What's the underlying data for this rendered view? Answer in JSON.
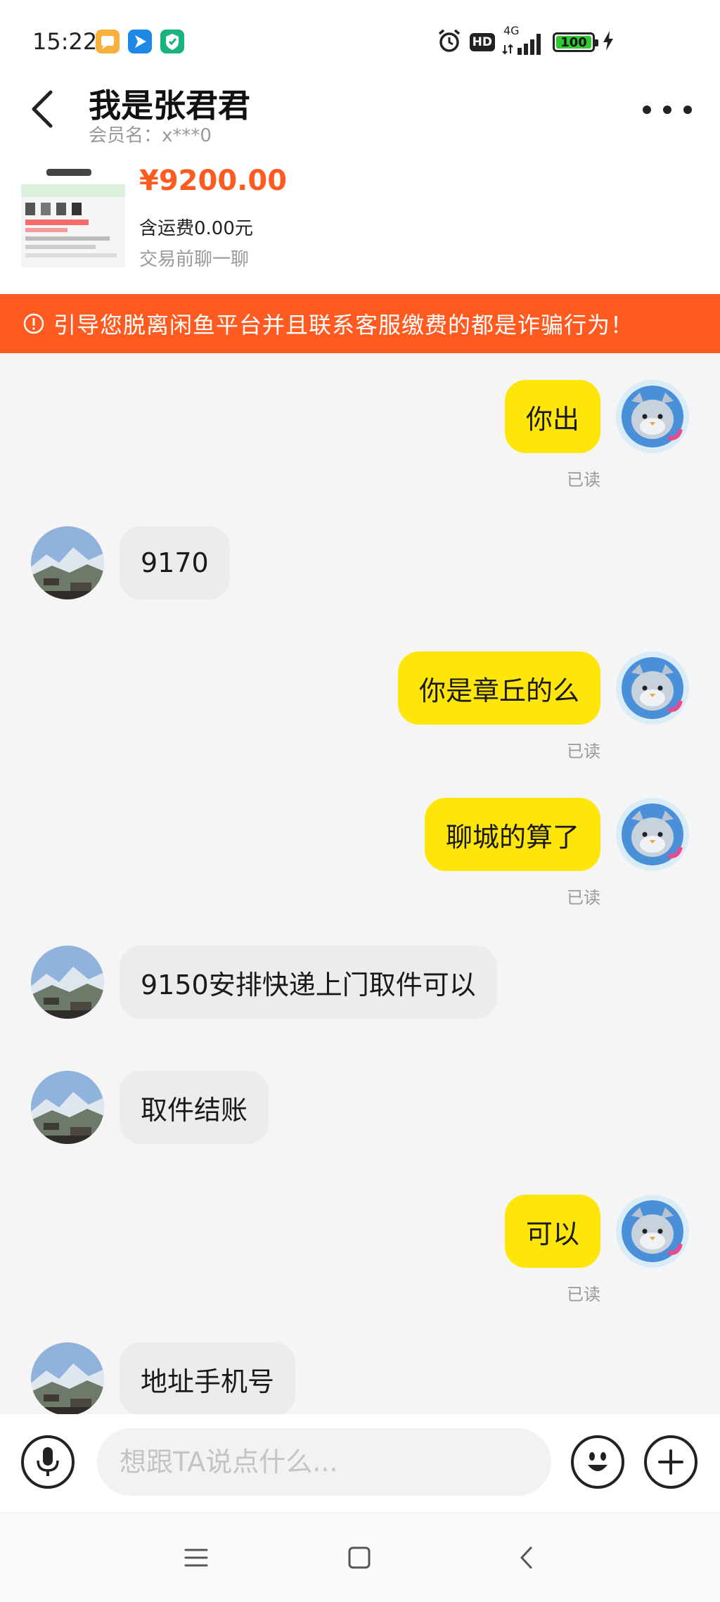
{
  "status_bar": {
    "time": "15:22",
    "network": "4G",
    "hd": "HD",
    "battery": "100",
    "icons": [
      "gallery-app-icon",
      "messenger-app-icon",
      "shield-app-icon",
      "alarm-icon",
      "hd-icon",
      "signal-icon",
      "battery-icon",
      "charging-icon"
    ]
  },
  "header": {
    "title": "我是张君君",
    "member_name": "会员名：x***0",
    "product": {
      "price": "¥9200.00",
      "shipping": "含运费0.00元",
      "hint": "交易前聊一聊"
    }
  },
  "warning": "引导您脱离闲鱼平台并且联系客服缴费的都是诈骗行为！",
  "messages": [
    {
      "from": "me",
      "text": "你出",
      "status": "已读"
    },
    {
      "from": "them",
      "text": "9170"
    },
    {
      "from": "me",
      "text": "你是章丘的么",
      "status": "已读"
    },
    {
      "from": "me",
      "text": "聊城的算了",
      "status": "已读"
    },
    {
      "from": "them",
      "text": "9150安排快递上门取件可以"
    },
    {
      "from": "them",
      "text": "取件结账"
    },
    {
      "from": "me",
      "text": "可以",
      "status": "已读"
    },
    {
      "from": "them",
      "text": "地址手机号"
    }
  ],
  "input": {
    "placeholder": "想跟TA说点什么..."
  },
  "colors": {
    "accent": "#ff5a1f",
    "my_bubble": "#ffe60a",
    "their_bubble": "#ececec"
  }
}
